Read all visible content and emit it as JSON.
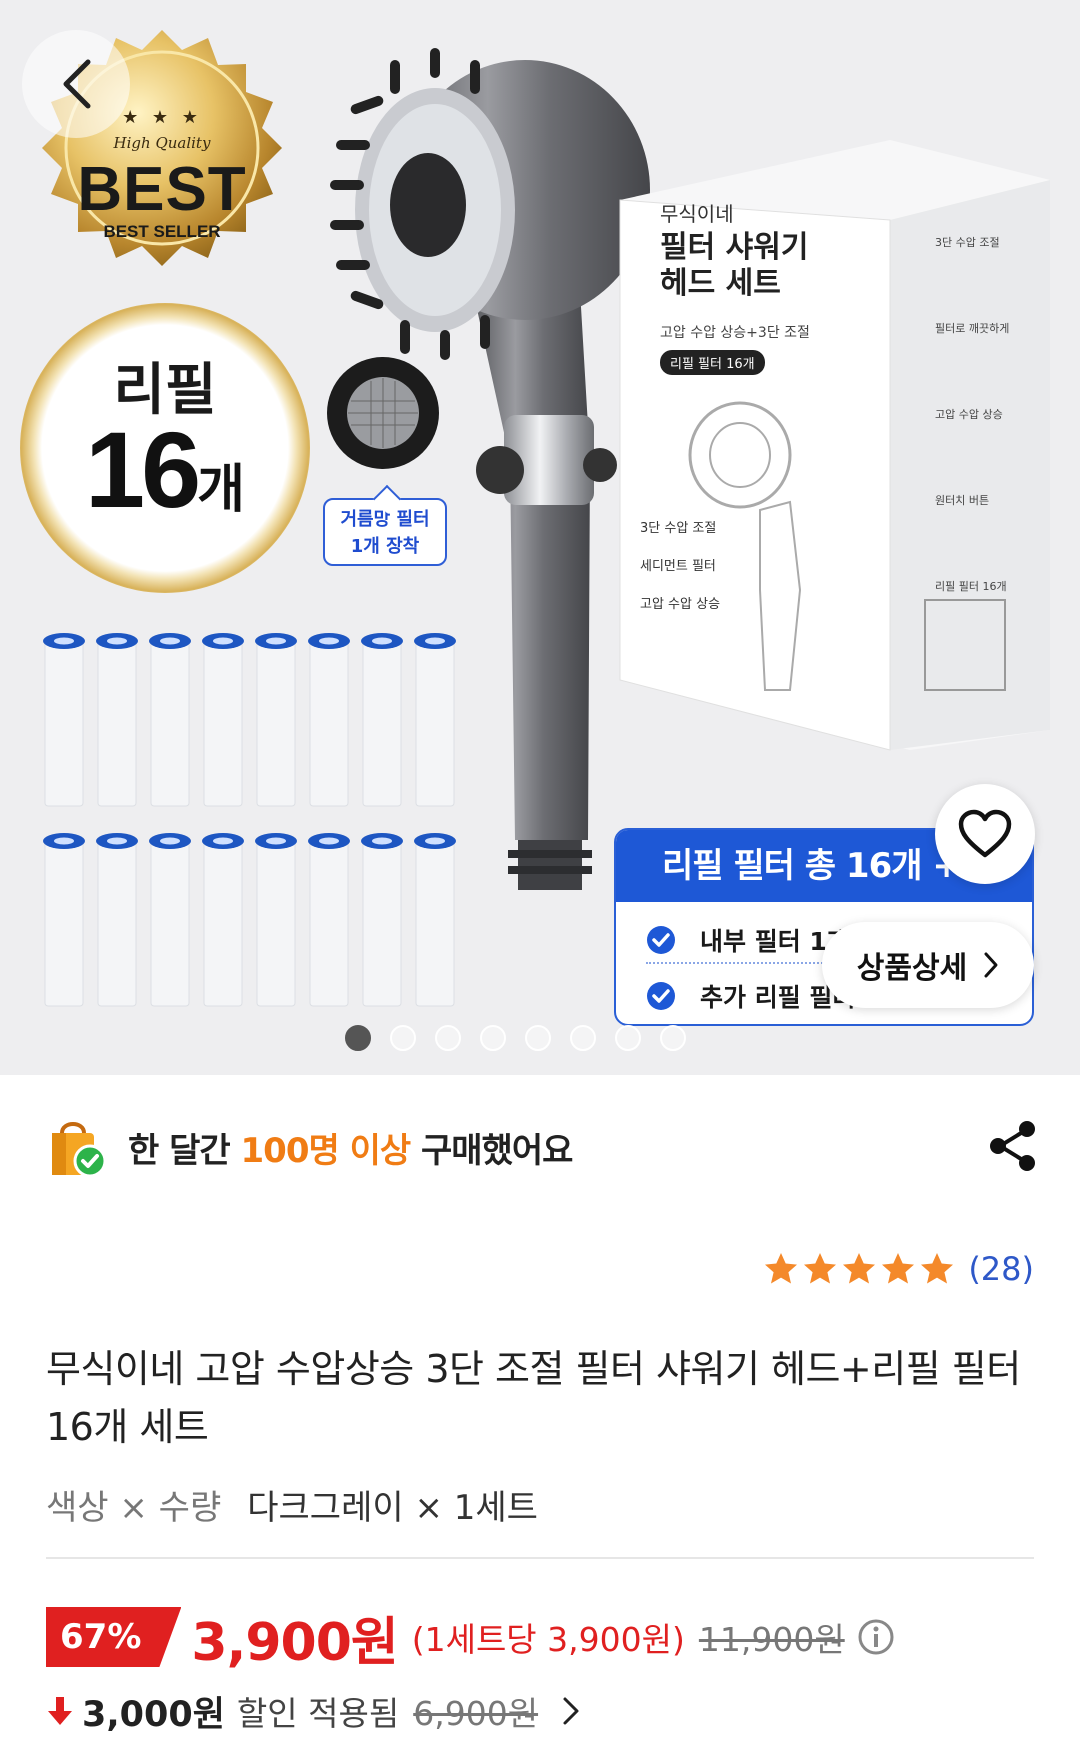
{
  "hero": {
    "best_badge": {
      "stars": "★ ★ ★",
      "quality": "High Quality",
      "best": "BEST",
      "seller": "BEST SELLER"
    },
    "refill_badge": {
      "line1": "리필",
      "count": "16",
      "unit": "개"
    },
    "mesh_callout": {
      "line1": "거름망 필터",
      "line2": "1개 장착"
    },
    "box": {
      "brand": "무식이네",
      "title_line1": "필터 샤워기",
      "title_line2": "헤드 세트",
      "subtitle": "고압 수압 상승+3단 조절",
      "tag": "리필 필터 16개",
      "features": [
        "3단 수압 조절",
        "세디먼트 필터",
        "고압 수압 상승"
      ],
      "side_features": [
        "3단 수압 조절",
        "필터로 깨끗하게",
        "고압 수압 상승",
        "원터치 버튼",
        "리필 필터 16개"
      ]
    },
    "refill_card": {
      "heading": "리필 필터 총 16개 +",
      "row1": "내부 필터 1개",
      "row2": "추가 리필 필터"
    },
    "detail_button": "상품상세",
    "dots": {
      "count": 8,
      "active": 0
    }
  },
  "social_proof": {
    "prefix": "한 달간 ",
    "highlight": "100명 이상",
    "suffix": " 구매했어요"
  },
  "rating": {
    "stars": 5,
    "count": "(28)"
  },
  "product_title": "무식이네 고압 수압상승 3단 조절 필터 샤워기 헤드+리필 필터 16개 세트",
  "option": {
    "label": "색상 × 수량",
    "value": "다크그레이 × 1세트"
  },
  "price": {
    "discount": "67%",
    "final": "3,900원",
    "unit": "(1세트당 3,900원)",
    "original": "11,900원"
  },
  "coupon": {
    "amount": "3,000원",
    "label": "할인 적용됨",
    "previous": "6,900원"
  },
  "colors": {
    "accent_red": "#e02020",
    "accent_orange": "#f07c14",
    "accent_blue": "#1e58d6",
    "star": "#f4892a"
  }
}
